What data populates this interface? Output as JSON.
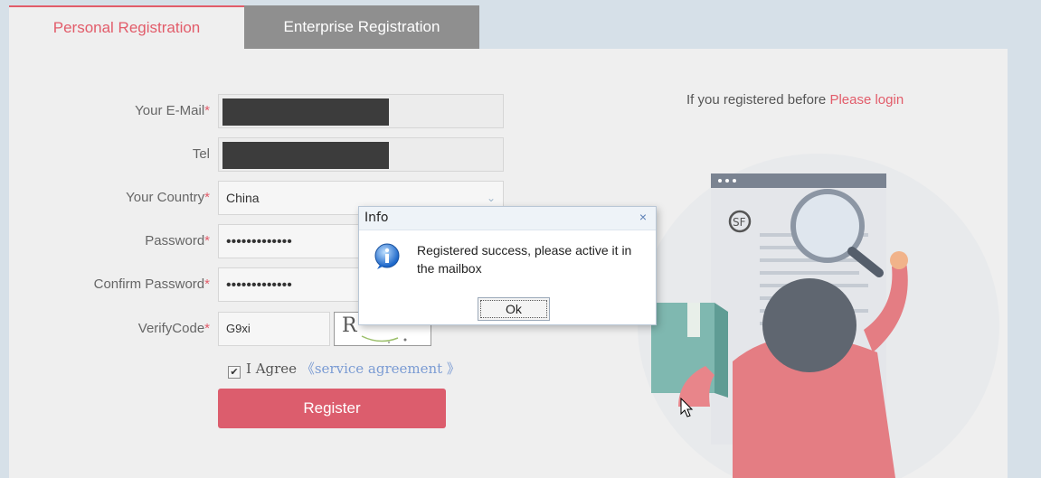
{
  "tabs": {
    "personal": "Personal Registration",
    "enterprise": "Enterprise Registration"
  },
  "form": {
    "email_label": "Your E-Mail",
    "tel_label": "Tel",
    "country_label": "Your Country",
    "country_value": "China",
    "password_label": "Password",
    "password_value": "•••••••••••••",
    "confirm_label": "Confirm Password",
    "confirm_value": "•••••••••••••",
    "verify_label": "VerifyCode",
    "verify_value": "G9xi",
    "captcha_text": "R",
    "required_mark": "*",
    "agree_label": "I Agree",
    "agree_link": "《service agreement 》",
    "register_button": "Register"
  },
  "login_hint": {
    "text": "If you registered before ",
    "link": "Please login"
  },
  "dialog": {
    "title": "Info",
    "close": "×",
    "message": "Registered success, please active it in the mailbox",
    "ok": "Ok"
  },
  "colors": {
    "accent": "#e25c6a",
    "button": "#dc5d6d",
    "tab_inactive": "#8f8f8f",
    "link": "#7a9bd3"
  }
}
